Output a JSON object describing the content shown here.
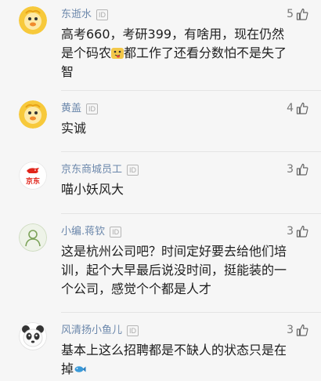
{
  "comments": [
    {
      "username": "东逝水",
      "badge": "ID",
      "likes": "5",
      "avatar": "duck-mascot-icon",
      "text_before_emoji": "高考660，考研399，有啥用，现在仍然是个码农",
      "emoji": "tongue-face-emoji",
      "text_after_emoji": "都工作了还看分数怕不是失了智"
    },
    {
      "username": "黄盖",
      "badge": "ID",
      "likes": "4",
      "avatar": "duck-mascot-icon",
      "text": "实诚"
    },
    {
      "username": "京东商城员工",
      "badge": "ID",
      "likes": "3",
      "avatar": "jd-logo-icon",
      "avatar_text": "京东",
      "text": "喵小妖风大"
    },
    {
      "username": "小编.蒋钦",
      "badge": "ID",
      "likes": "3",
      "avatar": "person-silhouette-icon",
      "text": "这是杭州公司吧？时间定好要去给他们培训，起个大早最后说没时间，挺能装的一个公司，感觉个个都是人才"
    },
    {
      "username": "风清扬小鱼儿",
      "badge": "ID",
      "likes": "3",
      "avatar": "panda-icon",
      "text_before_emoji": "基本上这么招聘都是不缺人的状态只是在掉",
      "emoji": "fish-emoji"
    }
  ],
  "colors": {
    "username": "#6b87ab",
    "jd_red": "#e1251b",
    "background": "#f6f6f6"
  }
}
